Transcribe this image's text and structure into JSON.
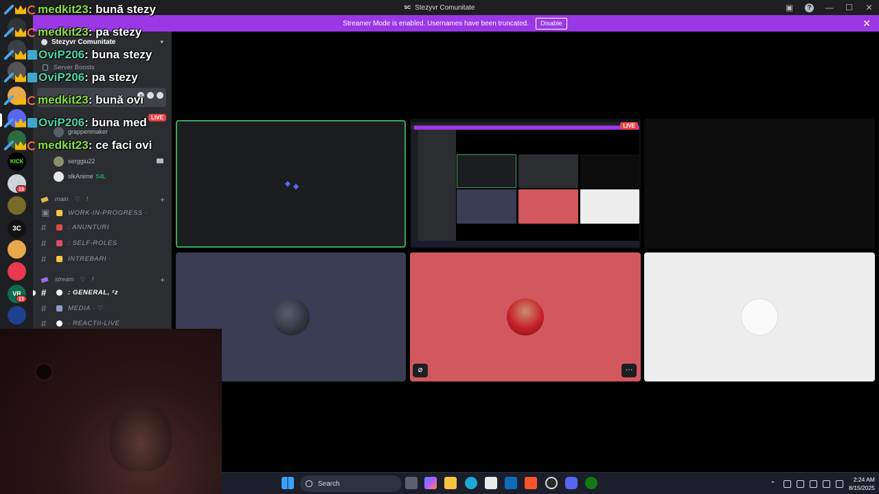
{
  "window": {
    "title": "Stezyvr Comunitate",
    "app_icon": "SC"
  },
  "banner": {
    "message": "Streamer Mode is enabled. Usernames have been truncated.",
    "button": "Disable"
  },
  "rail": {
    "badges": [
      "19",
      "13"
    ],
    "kick_label": "KICK",
    "tag_3c": "3C",
    "tag_vr": "VR"
  },
  "sidebar": {
    "server_name": "Stezyvr Comunitate",
    "boosts_label": "Server Boosts",
    "voice_users": [
      {
        "name": "grappenmaker"
      },
      {
        "name": "serggiu22"
      },
      {
        "name": "slkAnime",
        "tag": "S4L"
      }
    ],
    "categories": [
      {
        "label": "main ⠀♡ ⠀!"
      },
      {
        "label": "stream ⠀♡ ⠀!"
      }
    ],
    "channels": [
      {
        "label": "WORK-IN-PROGRESS ·"
      },
      {
        "label": ": ANUNTURI"
      },
      {
        "label": ": SELF-ROLES"
      },
      {
        "label": "INTREBARI ·"
      },
      {
        "label": ": GENERAL, ᶻz"
      },
      {
        "label": "MEDIA · ♡"
      },
      {
        "label": "· REACTII-LIVE"
      }
    ]
  },
  "chat": [
    {
      "user": "medkit23",
      "message": "bună stezy",
      "color": "#8be43f"
    },
    {
      "user": "medkit23",
      "message": "pa stezy",
      "color": "#8be43f"
    },
    {
      "user": "OviP206",
      "message": "buna stezy",
      "color": "#4fd8a6"
    },
    {
      "user": "OviP206",
      "message": "pa stezy",
      "color": "#4fd8a6"
    },
    {
      "user": "medkit23",
      "message": "bună ovi",
      "color": "#8be43f"
    },
    {
      "user": "OviP206",
      "message": "buna med",
      "color": "#4fd8a6"
    },
    {
      "user": "medkit23",
      "message": "ce faci ovi",
      "color": "#8be43f"
    }
  ],
  "stage": {
    "live_label": "LIVE",
    "sidebar_live_label": "LIVE",
    "more_button": "···"
  },
  "taskbar": {
    "search_placeholder": "Search",
    "time": "2:24 AM",
    "date": "8/15/2025"
  },
  "colors": {
    "accent": "#9b38e6",
    "speaking": "#3ba55d",
    "tile_blue": "#3b3d55",
    "tile_red": "#d2585e",
    "tile_light": "#ededed"
  }
}
